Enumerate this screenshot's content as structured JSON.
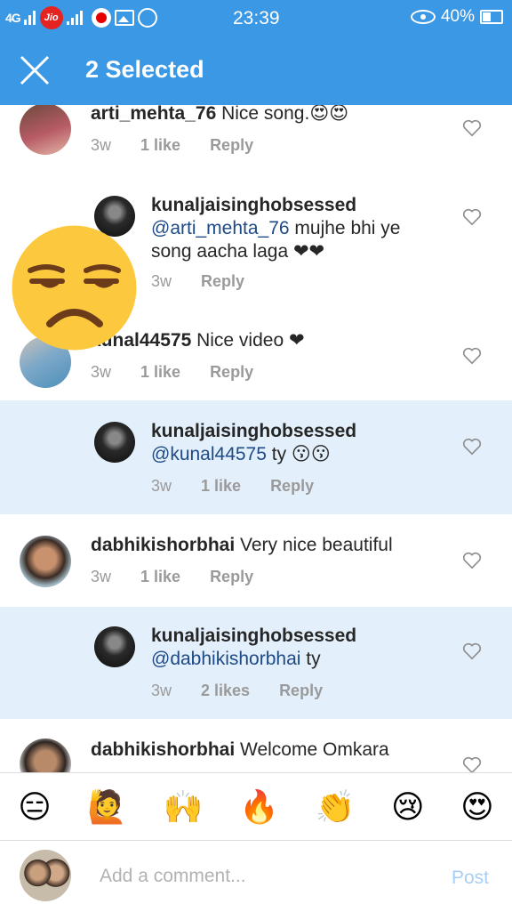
{
  "status_bar": {
    "network": "4G",
    "carrier_logo": "Jio",
    "time": "23:39",
    "battery": "40%"
  },
  "header": {
    "title": "2 Selected",
    "close_icon": "close-icon"
  },
  "comments": [
    {
      "user": "arti_mehta_76",
      "text": " Nice song.",
      "emoji": "😍😍",
      "time": "3w",
      "likes": "1 like",
      "reply": "Reply",
      "selected": false
    },
    {
      "user": "kunaljaisinghobsessed",
      "mention": "@arti_mehta_76",
      "text": " mujhe bhi ye song aacha laga ❤❤",
      "time": "3w",
      "reply": "Reply",
      "selected": false
    },
    {
      "user": "kunal44575",
      "text": " Nice video ❤",
      "time": "3w",
      "likes": "1 like",
      "reply": "Reply",
      "selected": false
    },
    {
      "user": "kunaljaisinghobsessed",
      "mention": "@kunal44575",
      "text": " ty 😗😗",
      "time": "3w",
      "likes": "1 like",
      "reply": "Reply",
      "selected": true
    },
    {
      "user": "dabhikishorbhai",
      "text": " Very nice beautiful",
      "time": "3w",
      "likes": "1 like",
      "reply": "Reply",
      "selected": false
    },
    {
      "user": "kunaljaisinghobsessed",
      "mention": "@dabhikishorbhai",
      "text": " ty",
      "time": "3w",
      "likes": "2 likes",
      "reply": "Reply",
      "selected": true
    },
    {
      "user": "dabhikishorbhai",
      "text": " Welcome Omkara",
      "selected": false
    }
  ],
  "emoji_bar": [
    "😑",
    "🙋",
    "🙌",
    "🔥",
    "👏",
    "😢",
    "😍"
  ],
  "comment_input": {
    "placeholder": "Add a comment...",
    "post_label": "Post"
  },
  "colors": {
    "header_blue": "#3b98e5",
    "selected_row": "#e3effb",
    "mention_blue": "#1d4a86",
    "post_disabled": "#a8cff4"
  }
}
